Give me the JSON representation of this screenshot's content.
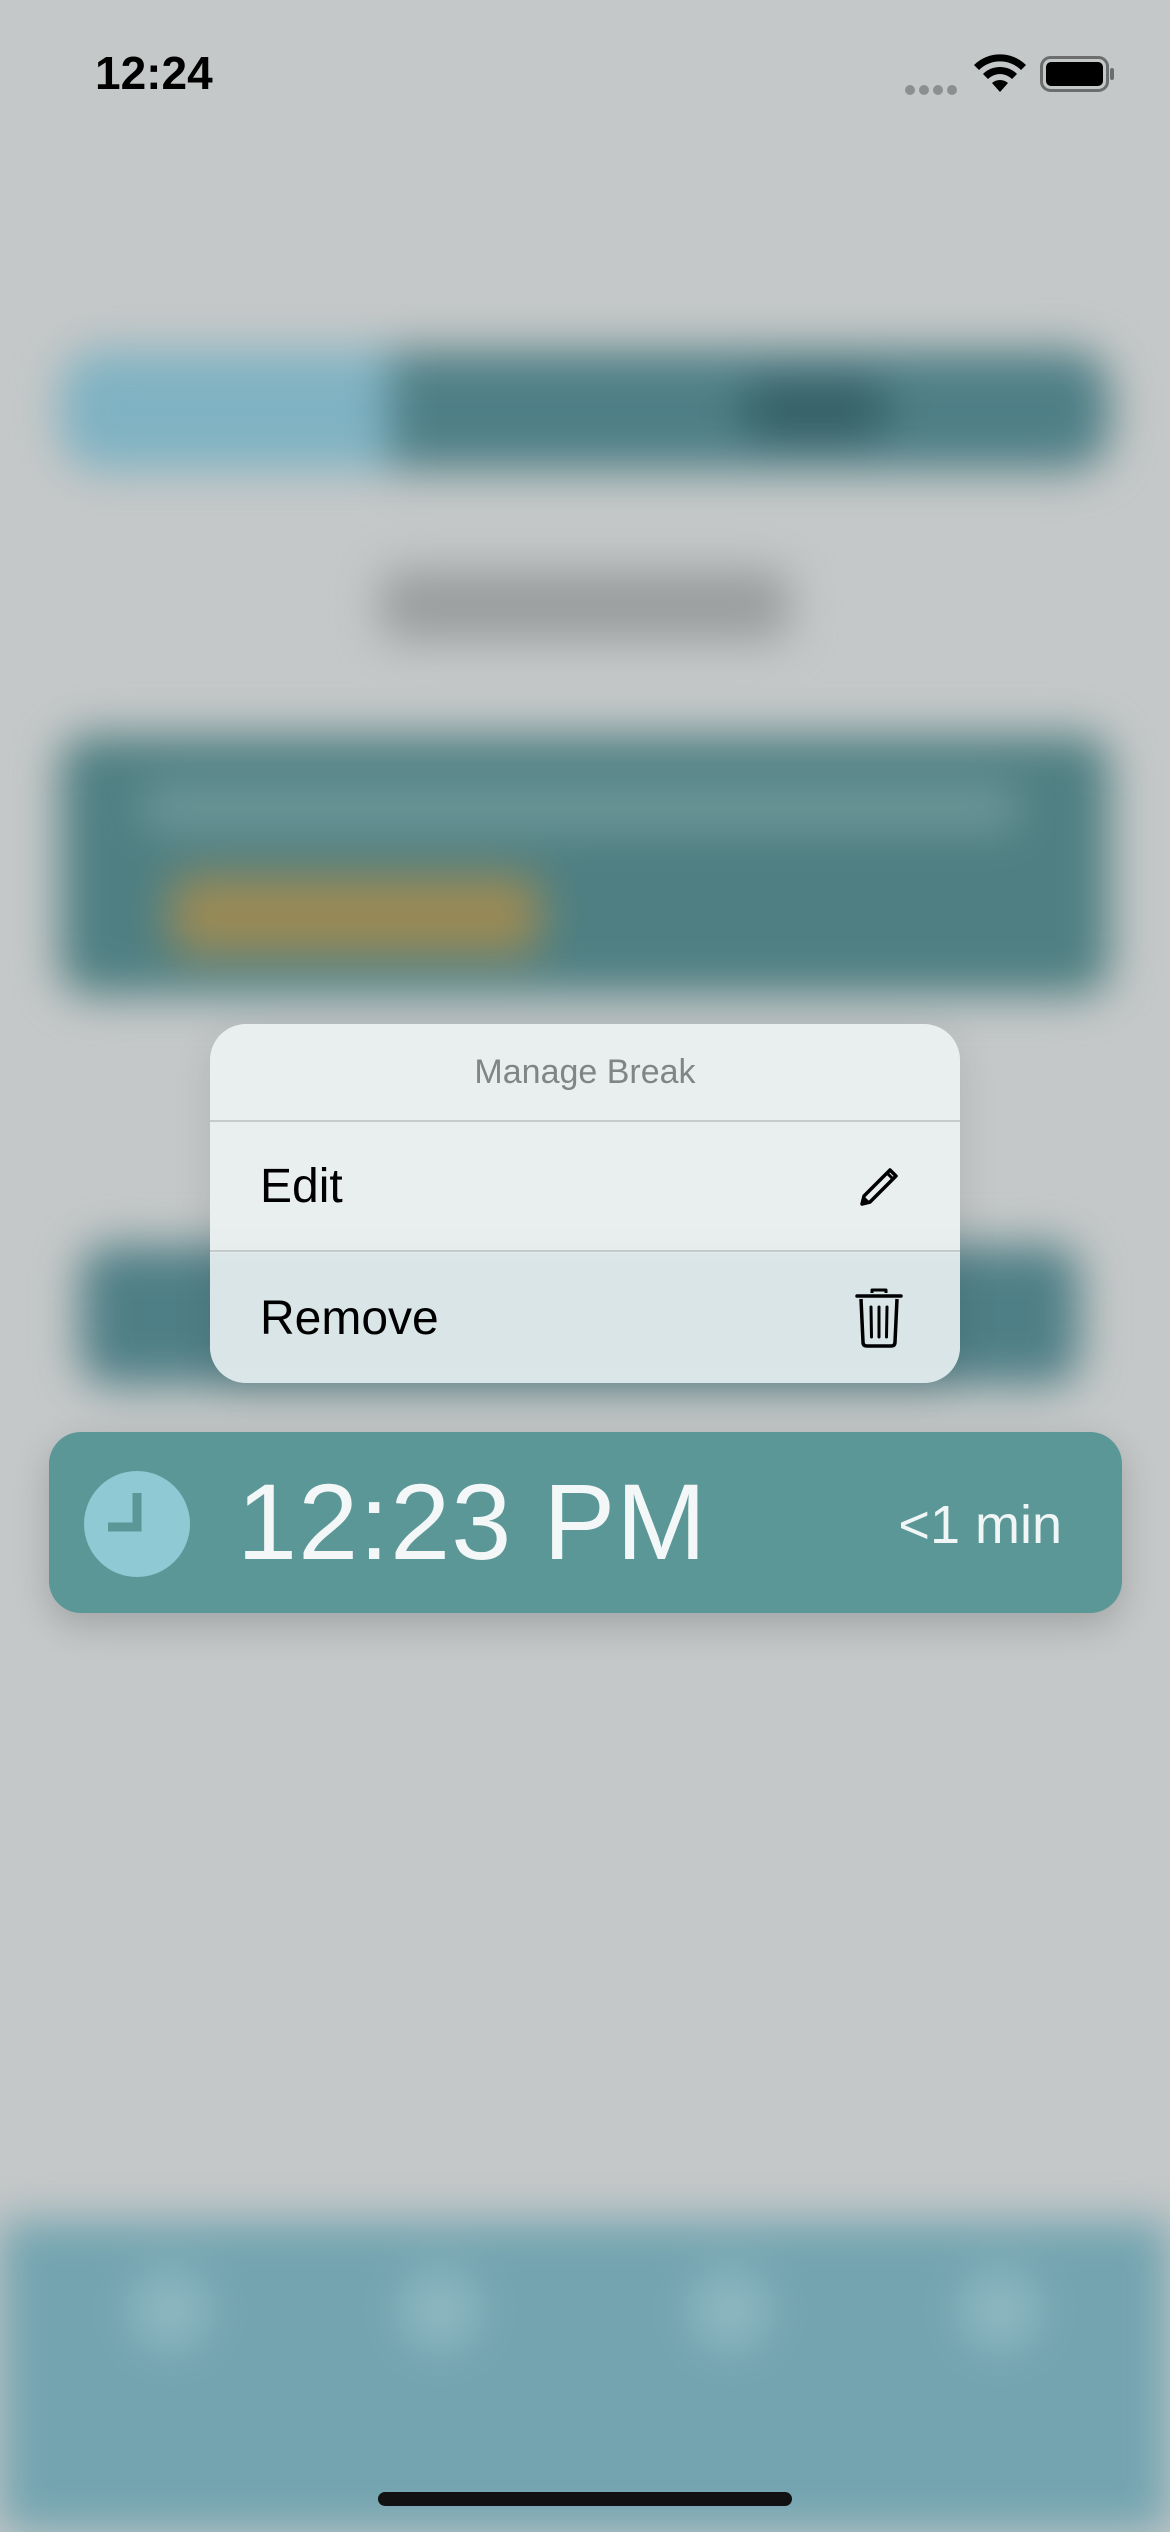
{
  "status_bar": {
    "time": "12:24"
  },
  "context_menu": {
    "title": "Manage Break",
    "items": [
      {
        "label": "Edit",
        "icon": "pencil-icon"
      },
      {
        "label": "Remove",
        "icon": "trash-icon"
      }
    ]
  },
  "break_row": {
    "time": "12:23 PM",
    "duration": "<1 min",
    "icon": "clock-icon"
  },
  "colors": {
    "row_background": "#5b9797",
    "clock_badge": "#8ec9d4",
    "dimmed_backdrop": "#c5c8c8"
  }
}
